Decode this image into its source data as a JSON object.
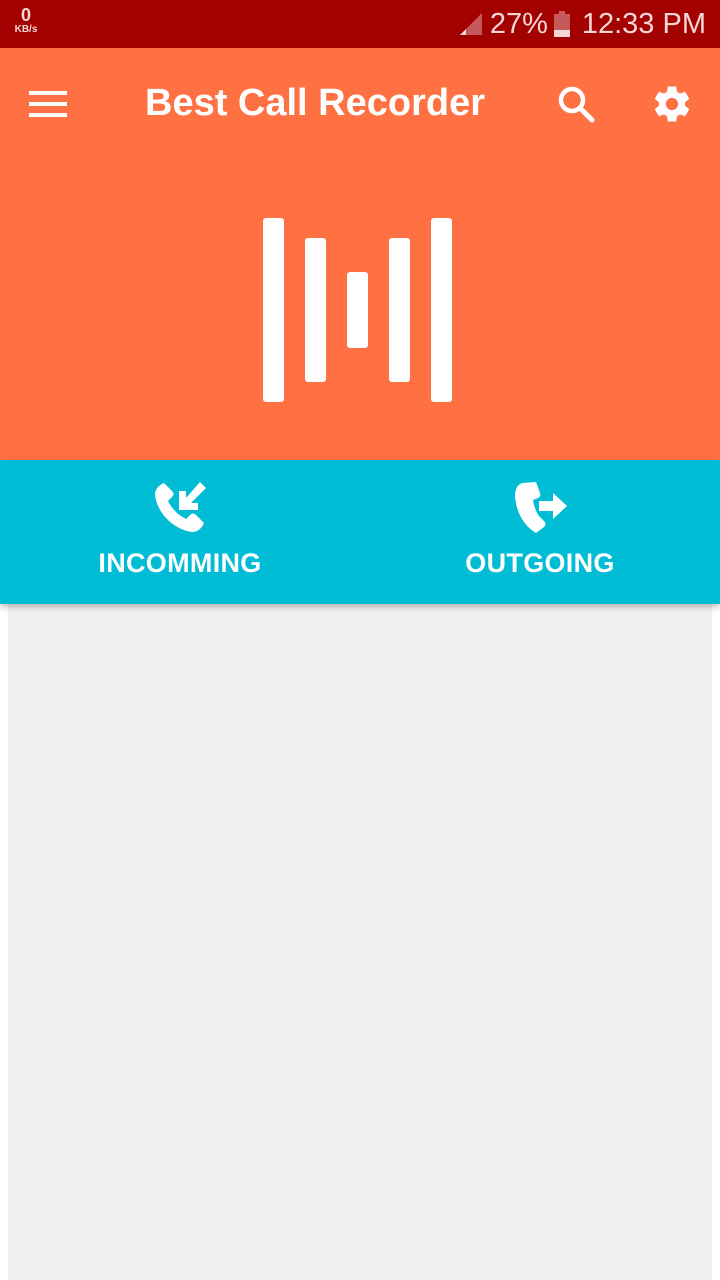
{
  "status_bar": {
    "speed_value": "0",
    "speed_unit": "KB/s",
    "battery": "27%",
    "time": "12:33 PM",
    "icons": [
      "signal-icon",
      "battery-icon"
    ]
  },
  "app_bar": {
    "title": "Best Call Recorder",
    "icons": [
      "menu-icon",
      "search-icon",
      "settings-icon",
      "recorder-logo-icon"
    ]
  },
  "tabs": [
    {
      "label": "INCOMMING",
      "icon": "incoming-call-icon"
    },
    {
      "label": "OUTGOING",
      "icon": "outgoing-call-icon"
    }
  ],
  "colors": {
    "status_bar": "#a30000",
    "app_bar": "#ff7043",
    "tab_bar": "#00bcd4",
    "content": "#f0f0f0"
  }
}
